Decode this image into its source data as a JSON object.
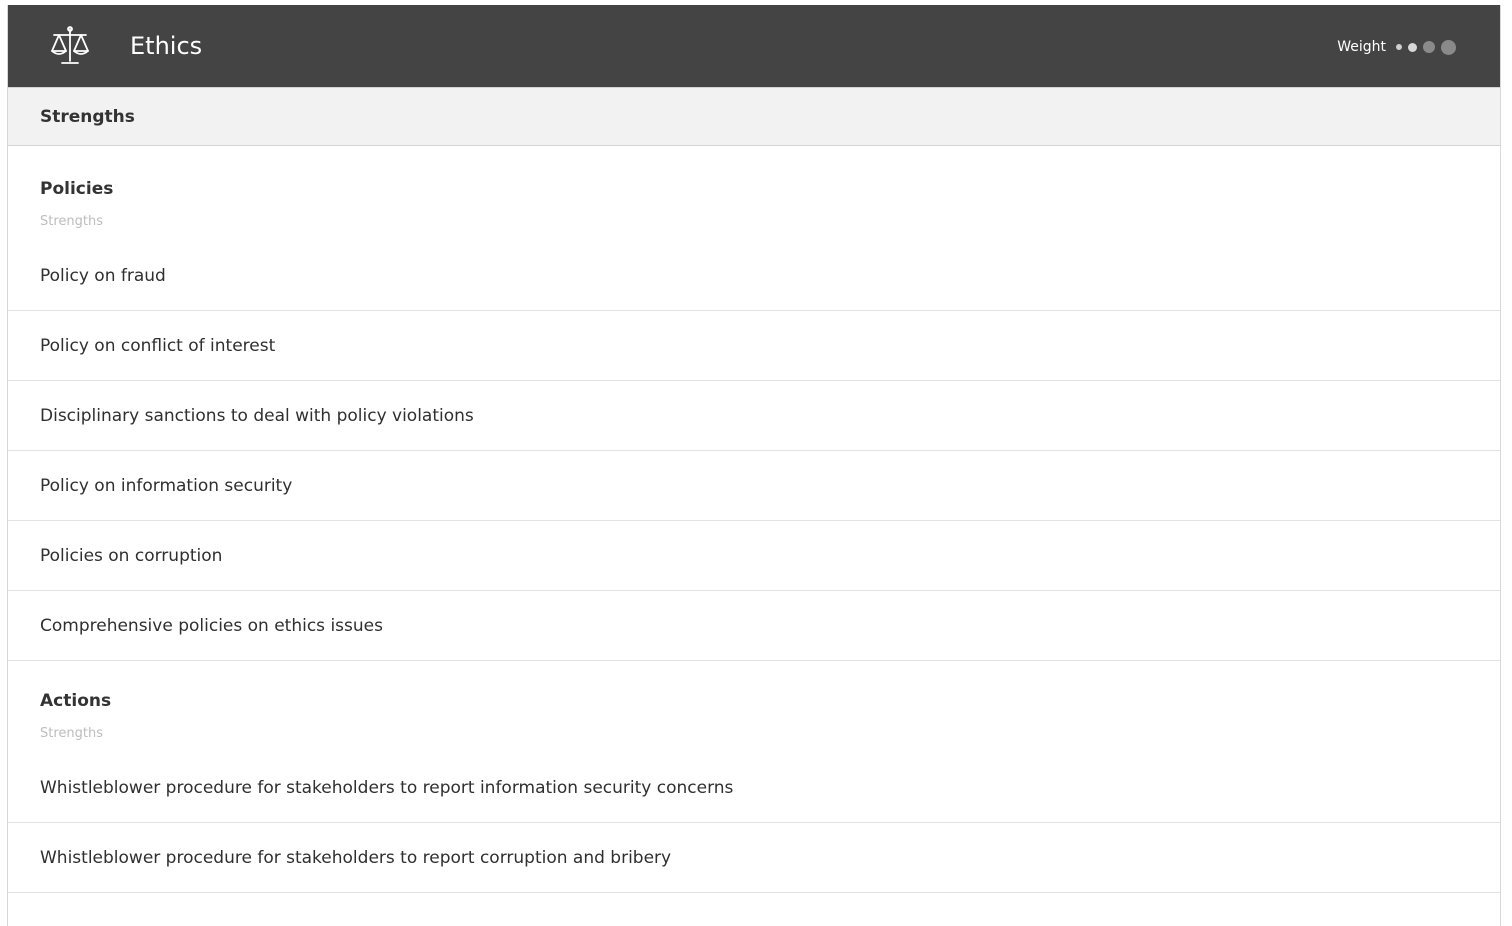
{
  "header": {
    "title": "Ethics",
    "icon": "scales-of-justice-icon",
    "weight_label": "Weight",
    "weight_level": 2,
    "weight_max": 4,
    "background": "#444444"
  },
  "section": {
    "title": "Strengths"
  },
  "groups": [
    {
      "title": "Policies",
      "subtitle": "Strengths",
      "items": [
        "Policy on fraud",
        "Policy on conflict of interest",
        "Disciplinary sanctions to deal with policy violations",
        "Policy on information security",
        "Policies on corruption",
        "Comprehensive policies on ethics issues"
      ]
    },
    {
      "title": "Actions",
      "subtitle": "Strengths",
      "items": [
        "Whistleblower procedure for stakeholders to report information security concerns",
        "Whistleblower procedure for stakeholders to report corruption and bribery"
      ]
    }
  ]
}
